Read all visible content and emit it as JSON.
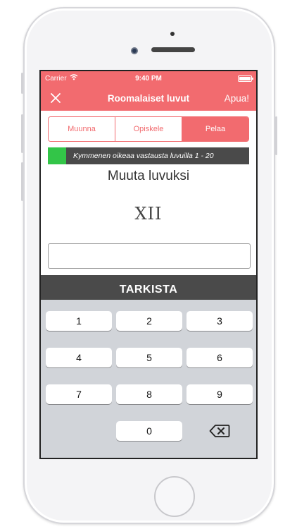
{
  "status_bar": {
    "carrier": "Carrier",
    "time": "9:40 PM"
  },
  "nav": {
    "close_icon": "close-icon",
    "title": "Roomalaiset luvut",
    "help": "Apua!"
  },
  "tabs": [
    {
      "label": "Muunna",
      "active": false
    },
    {
      "label": "Opiskele",
      "active": false
    },
    {
      "label": "Pelaa",
      "active": true
    }
  ],
  "progress": {
    "text": "Kymmenen oikeaa vastausta luvuilla 1 - 20",
    "fraction": 0.09
  },
  "question": {
    "prompt": "Muuta luvuksi",
    "numeral": "XII"
  },
  "answer": {
    "value": "",
    "placeholder": ""
  },
  "check_button": "TARKISTA",
  "keypad": {
    "keys": [
      "1",
      "2",
      "3",
      "4",
      "5",
      "6",
      "7",
      "8",
      "9",
      "0"
    ],
    "backspace_icon": "backspace-icon"
  },
  "colors": {
    "accent": "#f26b6f",
    "dark": "#4a4a4a",
    "progress_fill": "#33c548",
    "keypad_bg": "#d1d4d9"
  }
}
